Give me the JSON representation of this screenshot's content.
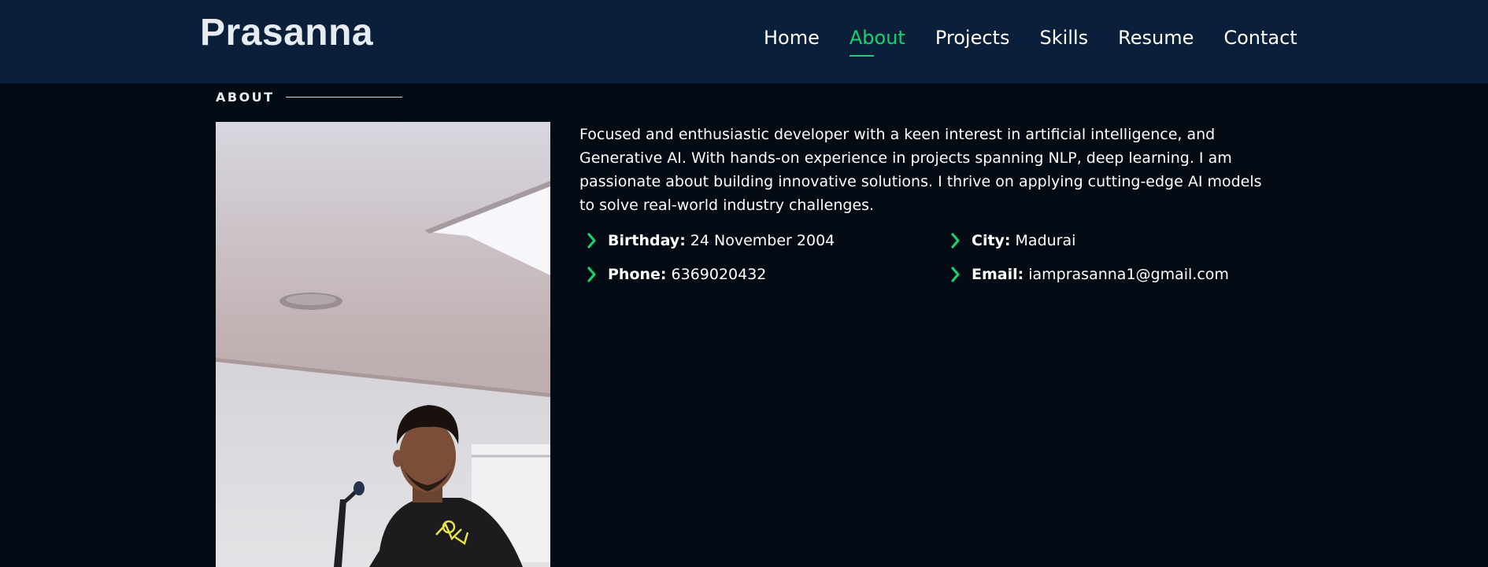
{
  "header": {
    "logo": "Prasanna",
    "nav": [
      {
        "label": "Home",
        "active": false
      },
      {
        "label": "About",
        "active": true
      },
      {
        "label": "Projects",
        "active": false
      },
      {
        "label": "Skills",
        "active": false
      },
      {
        "label": "Resume",
        "active": false
      },
      {
        "label": "Contact",
        "active": false
      }
    ]
  },
  "about": {
    "section_title": "ABOUT",
    "bio": "Focused and enthusiastic developer with a keen interest in artificial intelligence, and Generative AI. With hands-on experience in projects spanning NLP, deep learning. I am passionate about building innovative solutions. I thrive on applying cutting-edge AI models to solve real-world industry challenges.",
    "details": {
      "birthday_label": "Birthday:",
      "birthday_value": "24 November 2004",
      "city_label": "City:",
      "city_value": "Madurai",
      "phone_label": "Phone:",
      "phone_value": "6369020432",
      "email_label": "Email:",
      "email_value": "iamprasanna1@gmail.com"
    }
  },
  "colors": {
    "accent": "#18d26e",
    "header_bg": "#0a1f3a",
    "page_bg": "#040b14"
  },
  "icons": [
    "chevron-right-icon"
  ]
}
